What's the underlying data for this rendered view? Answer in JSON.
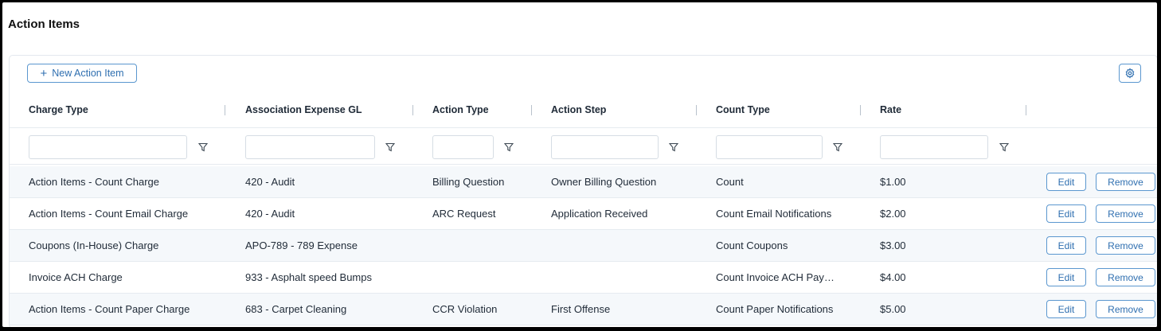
{
  "page": {
    "title": "Action Items"
  },
  "toolbar": {
    "new_label": "New Action Item",
    "plus_glyph": "+",
    "settings_icon": "gear-icon"
  },
  "columns": [
    {
      "key": "charge_type",
      "label": "Charge Type"
    },
    {
      "key": "expense_gl",
      "label": "Association Expense GL"
    },
    {
      "key": "action_type",
      "label": "Action Type"
    },
    {
      "key": "action_step",
      "label": "Action Step"
    },
    {
      "key": "count_type",
      "label": "Count Type"
    },
    {
      "key": "rate",
      "label": "Rate"
    }
  ],
  "row_actions": {
    "edit_label": "Edit",
    "remove_label": "Remove"
  },
  "rows": [
    {
      "charge_type": "Action Items - Count Charge",
      "expense_gl": "420 - Audit",
      "action_type": "Billing Question",
      "action_step": "Owner Billing Question",
      "count_type": "Count",
      "rate": "$1.00"
    },
    {
      "charge_type": "Action Items - Count Email Charge",
      "expense_gl": "420 - Audit",
      "action_type": "ARC Request",
      "action_step": "Application Received",
      "count_type": "Count Email Notifications",
      "rate": "$2.00"
    },
    {
      "charge_type": "Coupons (In-House) Charge",
      "expense_gl": "APO-789 - 789 Expense",
      "action_type": "",
      "action_step": "",
      "count_type": "Count Coupons",
      "rate": "$3.00"
    },
    {
      "charge_type": "Invoice ACH Charge",
      "expense_gl": "933 - Asphalt speed Bumps",
      "action_type": "",
      "action_step": "",
      "count_type": "Count Invoice ACH Pay…",
      "rate": "$4.00"
    },
    {
      "charge_type": "Action Items - Count Paper Charge",
      "expense_gl": "683 - Carpet Cleaning",
      "action_type": "CCR Violation",
      "action_step": "First Offense",
      "count_type": "Count Paper Notifications",
      "rate": "$5.00"
    }
  ]
}
